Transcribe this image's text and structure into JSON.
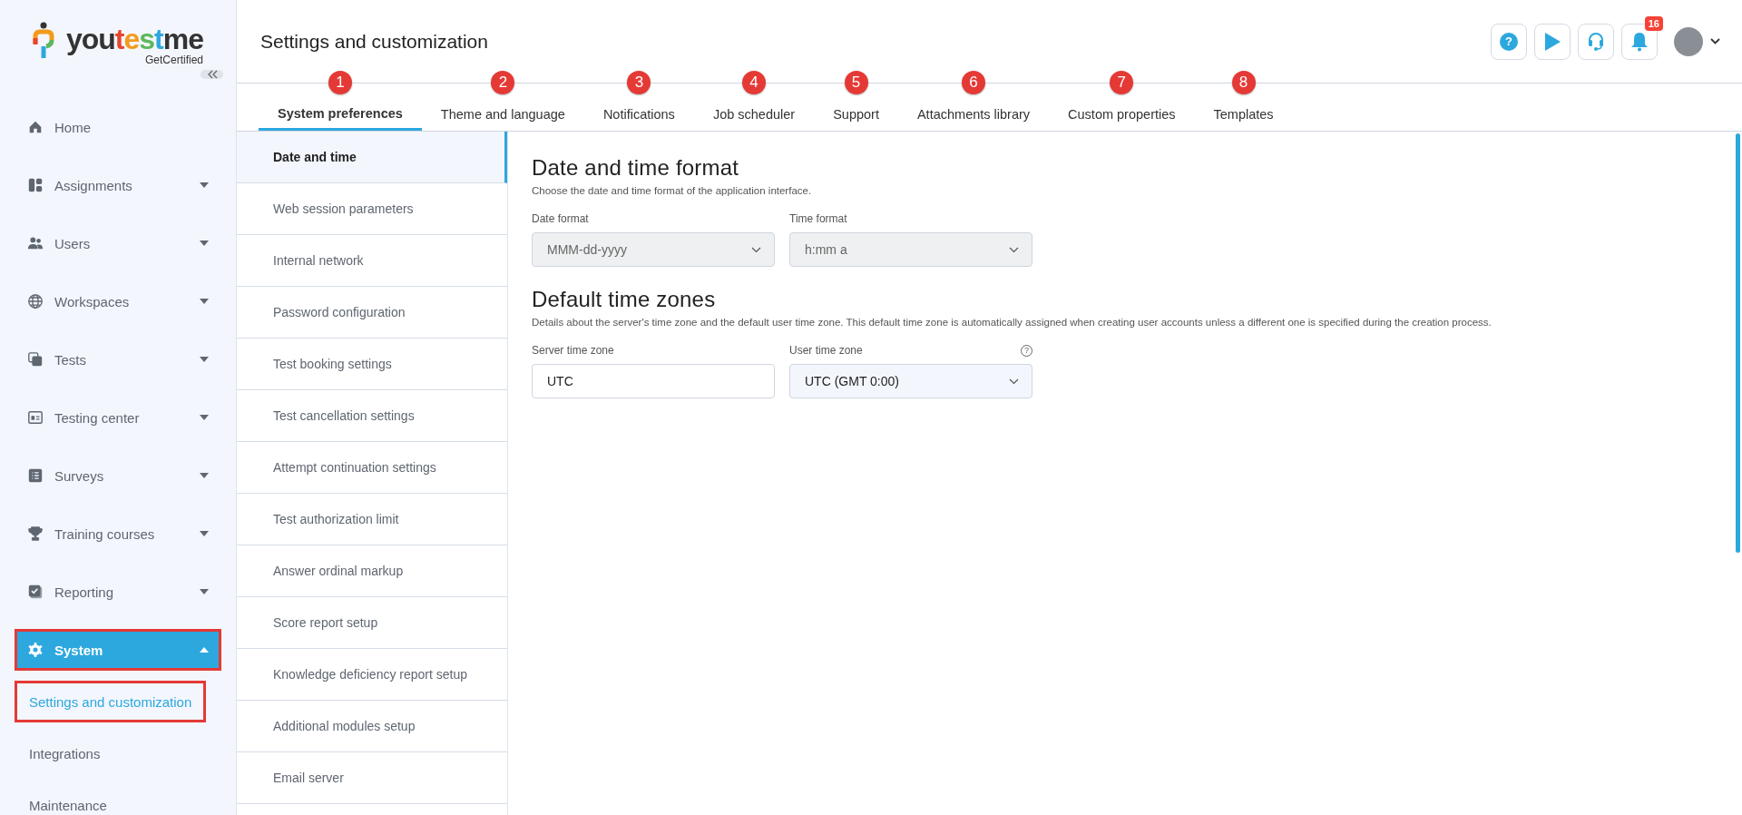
{
  "logo": {
    "parts": [
      "you",
      "t",
      "e",
      "s",
      "t",
      "me"
    ],
    "tagline": "GetCertified"
  },
  "sidebar": {
    "items": [
      {
        "label": "Home",
        "kind": "link",
        "selected": false,
        "highlighted": false
      },
      {
        "label": "Assignments",
        "kind": "group",
        "expanded": false,
        "selected": false,
        "highlighted": false
      },
      {
        "label": "Users",
        "kind": "group",
        "expanded": false,
        "selected": false,
        "highlighted": false
      },
      {
        "label": "Workspaces",
        "kind": "group",
        "expanded": false,
        "selected": false,
        "highlighted": false
      },
      {
        "label": "Tests",
        "kind": "group",
        "expanded": false,
        "selected": false,
        "highlighted": false
      },
      {
        "label": "Testing center",
        "kind": "group",
        "expanded": false,
        "selected": false,
        "highlighted": false
      },
      {
        "label": "Surveys",
        "kind": "group",
        "expanded": false,
        "selected": false,
        "highlighted": false
      },
      {
        "label": "Training courses",
        "kind": "group",
        "expanded": false,
        "selected": false,
        "highlighted": false
      },
      {
        "label": "Reporting",
        "kind": "group",
        "expanded": false,
        "selected": false,
        "highlighted": false
      },
      {
        "label": "System",
        "kind": "group",
        "expanded": true,
        "selected": true,
        "highlighted": true,
        "children": [
          {
            "label": "Settings and customization",
            "selected": true,
            "highlighted": true
          },
          {
            "label": "Integrations",
            "selected": false,
            "highlighted": false
          },
          {
            "label": "Maintenance",
            "selected": false,
            "highlighted": false
          }
        ]
      }
    ]
  },
  "header": {
    "title": "Settings and customization",
    "help_button": "?",
    "notification_count": "16"
  },
  "tabs": [
    {
      "label": "System preferences",
      "badge": "1",
      "selected": true
    },
    {
      "label": "Theme and language",
      "badge": "2",
      "selected": false
    },
    {
      "label": "Notifications",
      "badge": "3",
      "selected": false
    },
    {
      "label": "Job scheduler",
      "badge": "4",
      "selected": false
    },
    {
      "label": "Support",
      "badge": "5",
      "selected": false
    },
    {
      "label": "Attachments library",
      "badge": "6",
      "selected": false
    },
    {
      "label": "Custom properties",
      "badge": "7",
      "selected": false
    },
    {
      "label": "Templates",
      "badge": "8",
      "selected": false
    }
  ],
  "section_menu": [
    {
      "label": "Date and time",
      "selected": true
    },
    {
      "label": "Web session parameters",
      "selected": false
    },
    {
      "label": "Internal network",
      "selected": false
    },
    {
      "label": "Password configuration",
      "selected": false
    },
    {
      "label": "Test booking settings",
      "selected": false
    },
    {
      "label": "Test cancellation settings",
      "selected": false
    },
    {
      "label": "Attempt continuation settings",
      "selected": false
    },
    {
      "label": "Test authorization limit",
      "selected": false
    },
    {
      "label": "Answer ordinal markup",
      "selected": false
    },
    {
      "label": "Score report setup",
      "selected": false
    },
    {
      "label": "Knowledge deficiency report setup",
      "selected": false
    },
    {
      "label": "Additional modules setup",
      "selected": false
    },
    {
      "label": "Email server",
      "selected": false
    }
  ],
  "sections": [
    {
      "title": "Date and time format",
      "description": "Choose the date and time format of the application interface.",
      "fields": [
        {
          "label": "Date format",
          "kind": "dropdown",
          "value": "MMM-dd-yyyy",
          "disabled": true
        },
        {
          "label": "Time format",
          "kind": "dropdown",
          "value": "h:mm a",
          "disabled": true
        }
      ]
    },
    {
      "title": "Default time zones",
      "description": "Details about the server's time zone and the default user time zone. This default time zone is automatically assigned when creating user accounts unless a different one is specified during the creation process.",
      "fields": [
        {
          "label": "Server time zone",
          "kind": "text",
          "value": "UTC",
          "disabled": false
        },
        {
          "label": "User time zone",
          "kind": "dropdown",
          "value": "UTC (GMT 0:00)",
          "disabled": false,
          "help": "?"
        }
      ]
    }
  ]
}
